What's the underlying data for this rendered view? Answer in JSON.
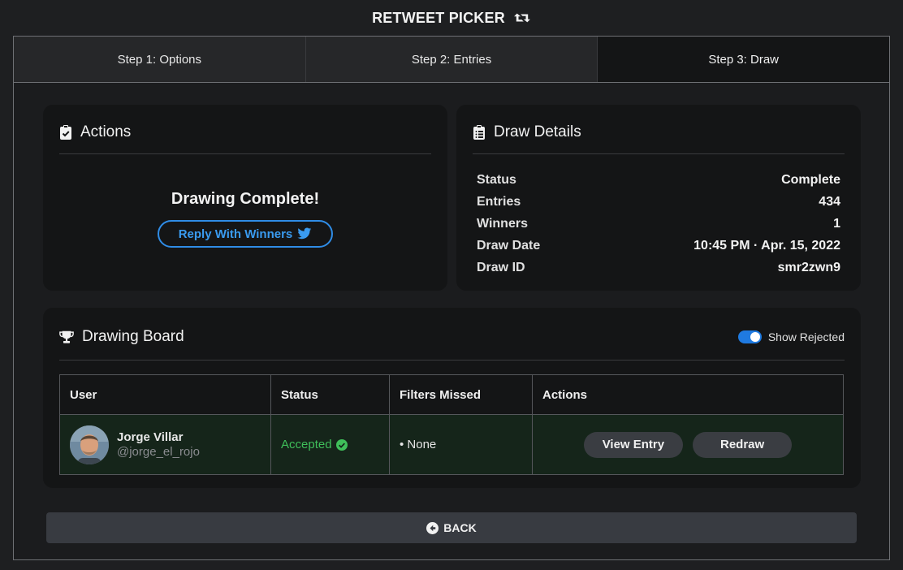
{
  "app": {
    "title": "RETWEET PICKER"
  },
  "tabs": [
    {
      "label": "Step 1: Options",
      "active": false
    },
    {
      "label": "Step 2: Entries",
      "active": false
    },
    {
      "label": "Step 3: Draw",
      "active": true
    }
  ],
  "actions": {
    "title": "Actions",
    "status_message": "Drawing Complete!",
    "reply_label": "Reply With Winners"
  },
  "details": {
    "title": "Draw Details",
    "rows": [
      {
        "key": "Status",
        "value": "Complete"
      },
      {
        "key": "Entries",
        "value": "434"
      },
      {
        "key": "Winners",
        "value": "1"
      },
      {
        "key": "Draw Date",
        "value": "10:45 PM · Apr. 15, 2022"
      },
      {
        "key": "Draw ID",
        "value": "smr2zwn9"
      }
    ]
  },
  "board": {
    "title": "Drawing Board",
    "toggle_label": "Show Rejected",
    "toggle_on": true,
    "columns": [
      "User",
      "Status",
      "Filters Missed",
      "Actions"
    ],
    "rows": [
      {
        "name": "Jorge Villar",
        "handle": "@jorge_el_rojo",
        "status": "Accepted",
        "filters": "• None",
        "view_label": "View Entry",
        "redraw_label": "Redraw"
      }
    ]
  },
  "footer": {
    "back_label": "BACK"
  },
  "colors": {
    "accent": "#2f8ce6",
    "accepted": "#3fbf5a",
    "toggle": "#1f7ae0"
  },
  "icons": {
    "title": "retweet-icon",
    "actions": "clipboard-check-icon",
    "details": "clipboard-list-icon",
    "board": "trophy-icon",
    "reply": "twitter-icon",
    "status": "check-circle-icon",
    "back": "arrow-circle-left-icon"
  }
}
